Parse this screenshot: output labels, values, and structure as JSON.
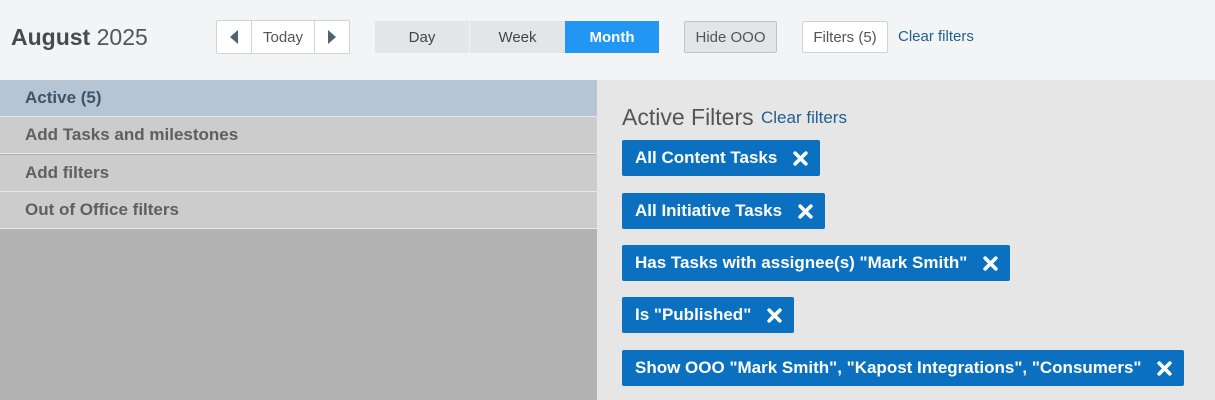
{
  "header": {
    "month": "August",
    "year": "2025",
    "today_label": "Today",
    "views": [
      {
        "label": "Day",
        "active": false
      },
      {
        "label": "Week",
        "active": false
      },
      {
        "label": "Month",
        "active": true
      }
    ],
    "hide_ooo_label": "Hide OOO",
    "filters_label": "Filters (5)",
    "clear_filters_label": "Clear filters"
  },
  "sidebar": {
    "items": [
      {
        "label": "Active (5)",
        "active": true
      },
      {
        "label": "Add Tasks and milestones",
        "active": false
      },
      {
        "label": "Add filters",
        "active": false
      },
      {
        "label": "Out of Office filters",
        "active": false
      }
    ]
  },
  "main": {
    "title": "Active Filters",
    "clear_label": "Clear filters",
    "filters": [
      {
        "label": "All Content Tasks"
      },
      {
        "label": "All Initiative Tasks"
      },
      {
        "label": "Has Tasks with assignee(s) \"Mark Smith\""
      },
      {
        "label": "Is \"Published\""
      },
      {
        "label": "Show OOO \"Mark Smith\", \"Kapost Integrations\", \"Consumers\""
      }
    ]
  },
  "colors": {
    "accent": "#2196f3",
    "chip": "#0a70bf",
    "link": "#1f5f8f",
    "sidebar_active": "#b5c5d3"
  },
  "icons": {
    "prev": "caret-left-icon",
    "next": "caret-right-icon",
    "remove": "close-x-icon"
  }
}
